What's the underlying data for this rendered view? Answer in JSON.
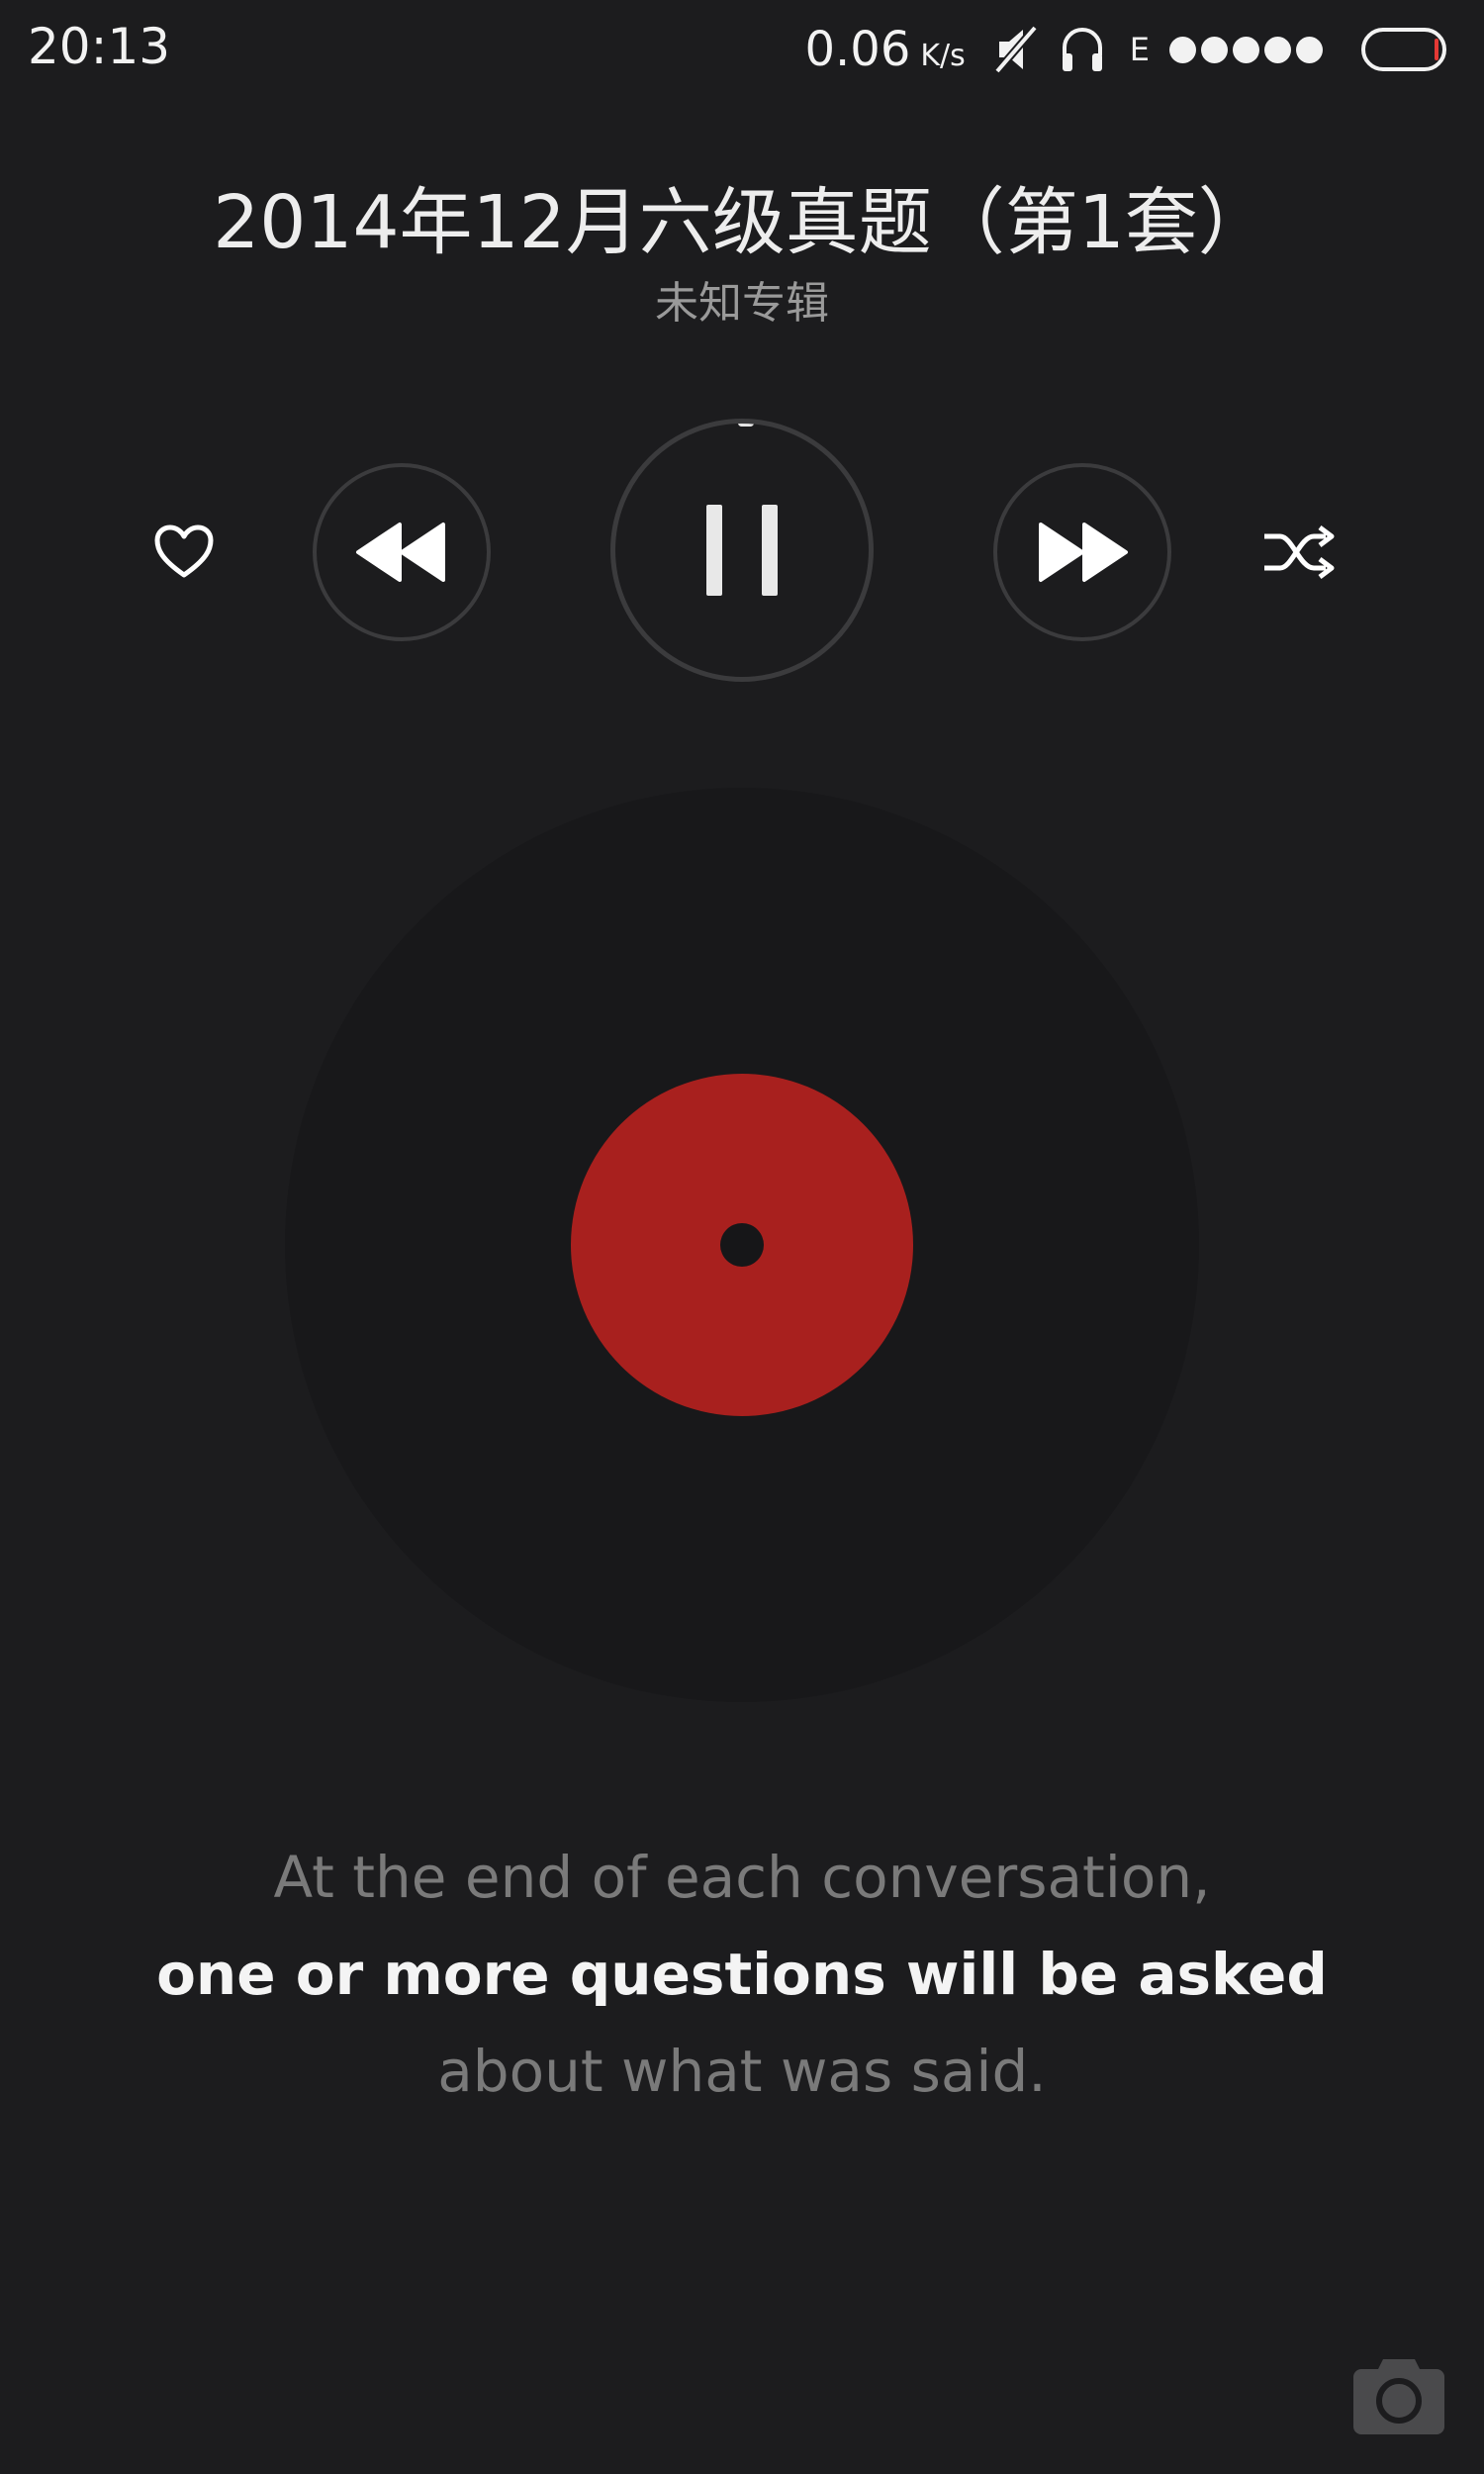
{
  "status_bar": {
    "time": "20:13",
    "net_speed": "0.06",
    "net_speed_unit": "K/s",
    "network_type": "E",
    "signal_level": 5,
    "icons": [
      "mute-icon",
      "headphones-icon",
      "battery-icon"
    ],
    "battery_level": 0.04,
    "battery_color": "#e53935"
  },
  "song": {
    "title": "2014年12月六级真题（第1套）",
    "album": "未知专辑"
  },
  "controls": {
    "favorite": "heart-icon",
    "previous": "rewind-icon",
    "play_pause": "pause-icon",
    "next": "fast-forward-icon",
    "mode": "shuffle-icon"
  },
  "vinyl": {
    "label_color": "#a8201e"
  },
  "lyrics": {
    "previous_line": "At the end of each conversation,",
    "current_line": "one or more questions will be asked",
    "next_line": "about what was said."
  },
  "floating": {
    "camera": "camera-icon"
  }
}
